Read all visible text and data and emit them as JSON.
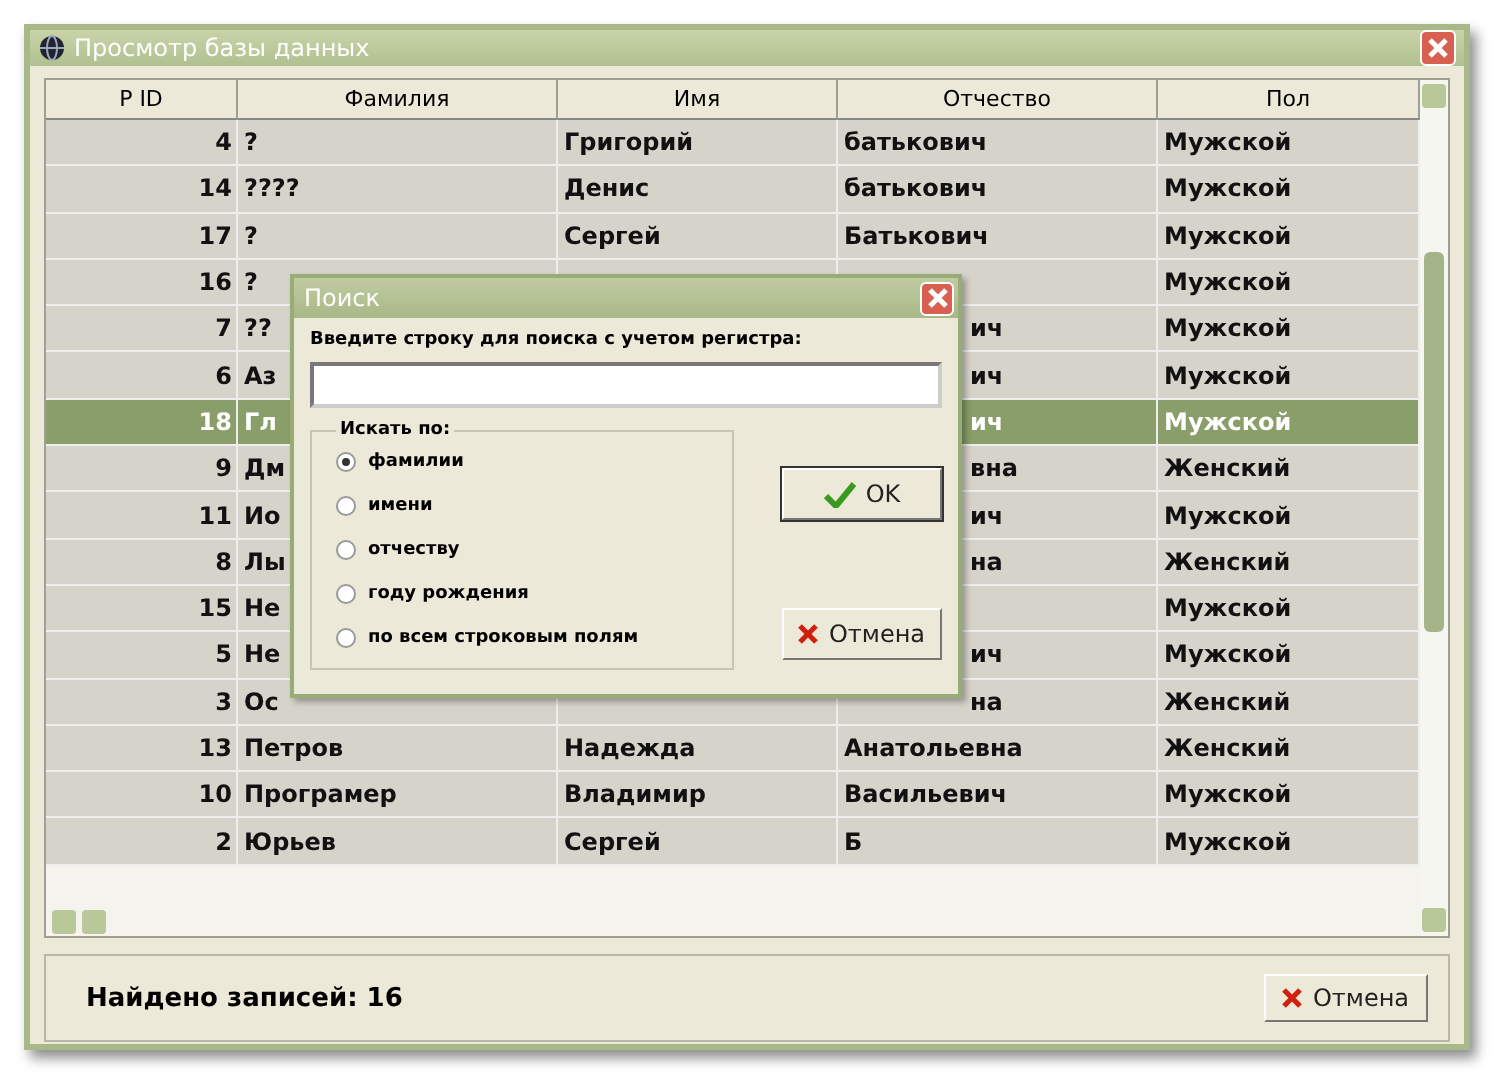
{
  "window": {
    "title": "Просмотр базы данных"
  },
  "table": {
    "columns": [
      "P ID",
      "Фамилия",
      "Имя",
      "Отчество",
      "Пол"
    ],
    "rows": [
      {
        "id": "4",
        "surname": "?",
        "name": "Григорий",
        "patronymic": "батькович",
        "sex": "Мужской",
        "selected": false
      },
      {
        "id": "14",
        "surname": "????",
        "name": "Денис",
        "patronymic": "батькович",
        "sex": "Мужской",
        "selected": false
      },
      {
        "id": "17",
        "surname": "?",
        "name": "Сергей",
        "patronymic": "Батькович",
        "sex": "Мужской",
        "selected": false
      },
      {
        "id": "16",
        "surname": "?",
        "sex": "Мужской",
        "selected": false
      },
      {
        "id": "7",
        "surname": "??",
        "patronymic_tail": "ич",
        "sex": "Мужской",
        "selected": false
      },
      {
        "id": "6",
        "surname": "Аз",
        "patronymic_tail": "ич",
        "sex": "Мужской",
        "selected": false
      },
      {
        "id": "18",
        "surname": "Гл",
        "patronymic_tail": "ич",
        "sex": "Мужской",
        "selected": true
      },
      {
        "id": "9",
        "surname": "Дм",
        "patronymic_tail": "вна",
        "sex": "Женский",
        "selected": false
      },
      {
        "id": "11",
        "surname": "Ио",
        "patronymic_tail": "ич",
        "sex": "Мужской",
        "selected": false
      },
      {
        "id": "8",
        "surname": "Лы",
        "patronymic_tail": "на",
        "sex": "Женский",
        "selected": false
      },
      {
        "id": "15",
        "surname": "Не",
        "sex": "Мужской",
        "selected": false
      },
      {
        "id": "5",
        "surname": "Не",
        "patronymic_tail": "ич",
        "sex": "Мужской",
        "selected": false
      },
      {
        "id": "3",
        "surname": "Ос",
        "patronymic_tail": "на",
        "sex": "Женский",
        "selected": false
      },
      {
        "id": "13",
        "surname": "Петров",
        "name": "Надежда",
        "patronymic": "Анатольевна",
        "sex": "Женский",
        "selected": false
      },
      {
        "id": "10",
        "surname": "Програмер",
        "name": "Владимир",
        "patronymic": "Васильевич",
        "sex": "Мужской",
        "selected": false
      },
      {
        "id": "2",
        "surname": "Юрьев",
        "name": "Сергей",
        "patronymic": "Б",
        "sex": "Мужской",
        "selected": false
      }
    ]
  },
  "dialog": {
    "title": "Поиск",
    "prompt": "Введите строку для поиска с учетом регистра:",
    "search_by": {
      "title": "Искать по:",
      "options": [
        {
          "label": "фамилии",
          "selected": true
        },
        {
          "label": "имени",
          "selected": false
        },
        {
          "label": "отчеству",
          "selected": false
        },
        {
          "label": "году рождения",
          "selected": false
        },
        {
          "label": "по всем строковым полям",
          "selected": false
        }
      ]
    },
    "buttons": [
      {
        "label": "OK",
        "kind": "ok"
      },
      {
        "label": "Отмена",
        "kind": "cancel"
      }
    ]
  },
  "status_bar": {
    "text": "Найдено записей: 16",
    "button": "Отмена"
  }
}
